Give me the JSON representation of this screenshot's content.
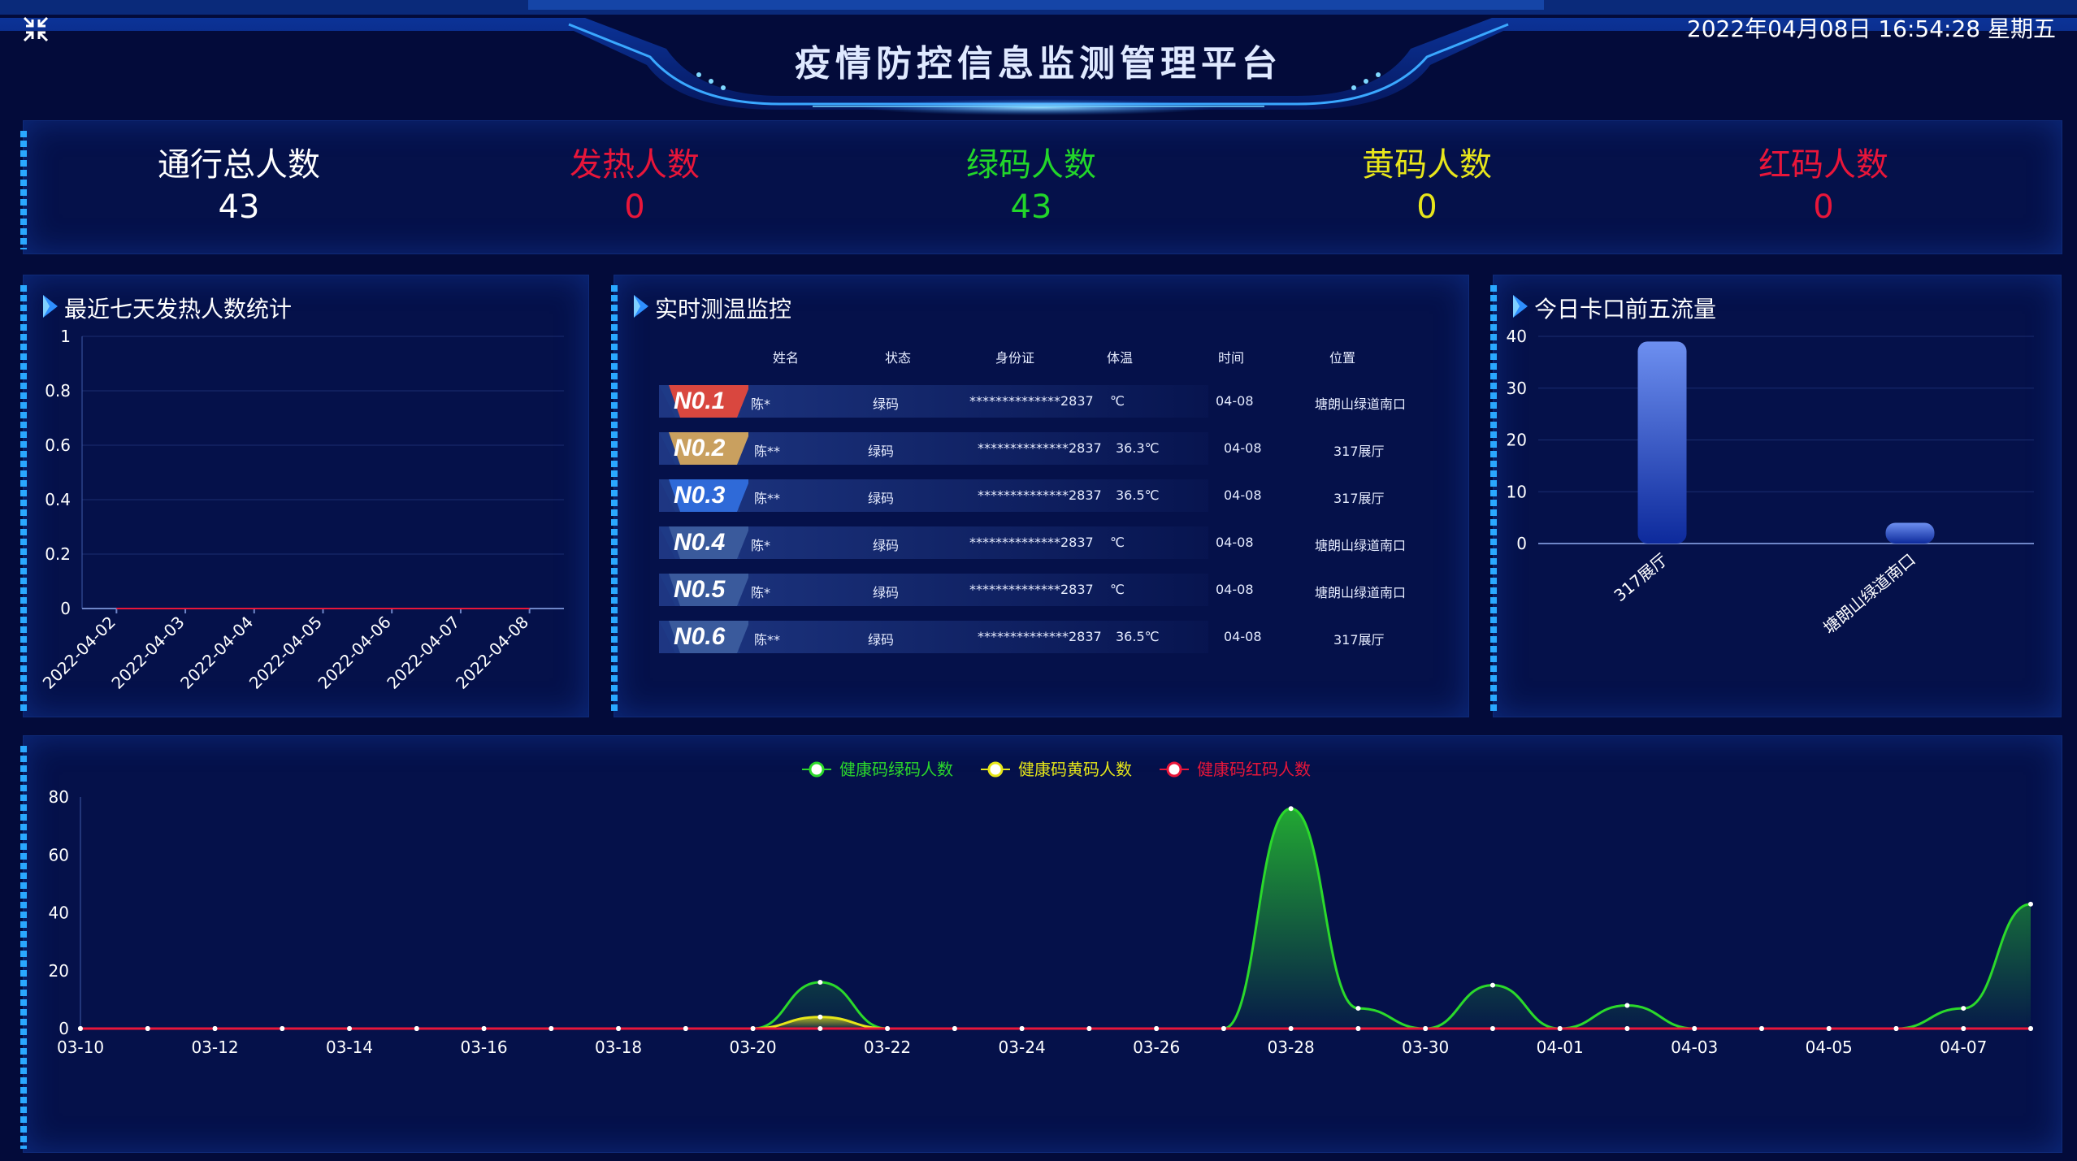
{
  "header": {
    "title": "疫情防控信息监测管理平台",
    "datetime": "2022年04月08日 16:54:28 星期五"
  },
  "stats": [
    {
      "label": "通行总人数",
      "value": "43",
      "color": "#ffffff"
    },
    {
      "label": "发热人数",
      "value": "0",
      "color": "#e8163a"
    },
    {
      "label": "绿码人数",
      "value": "43",
      "color": "#22d62a"
    },
    {
      "label": "黄码人数",
      "value": "0",
      "color": "#e7e51b"
    },
    {
      "label": "红码人数",
      "value": "0",
      "color": "#e8163a"
    }
  ],
  "fever_panel": {
    "title": "最近七天发热人数统计",
    "chart_data": {
      "type": "line",
      "categories": [
        "2022-04-02",
        "2022-04-03",
        "2022-04-04",
        "2022-04-05",
        "2022-04-06",
        "2022-04-07",
        "2022-04-08"
      ],
      "values": [
        0,
        0,
        0,
        0,
        0,
        0,
        0
      ],
      "yticks": [
        "1",
        "0.8",
        "0.6",
        "0.4",
        "0.2",
        "0"
      ],
      "ylim": [
        0,
        1
      ]
    }
  },
  "temp_panel": {
    "title": "实时测温监控",
    "headers": [
      "姓名",
      "状态",
      "身份证",
      "体温",
      "时间",
      "位置"
    ],
    "rows": [
      {
        "rank": "N0.1",
        "name": "陈*",
        "status": "绿码",
        "id": "**************2837",
        "temp": "℃",
        "time": "04-08",
        "location": "塘朗山绿道南口"
      },
      {
        "rank": "N0.2",
        "name": "陈**",
        "status": "绿码",
        "id": "**************2837",
        "temp": "36.3℃",
        "time": "04-08",
        "location": "317展厅"
      },
      {
        "rank": "N0.3",
        "name": "陈**",
        "status": "绿码",
        "id": "**************2837",
        "temp": "36.5℃",
        "time": "04-08",
        "location": "317展厅"
      },
      {
        "rank": "N0.4",
        "name": "陈*",
        "status": "绿码",
        "id": "**************2837",
        "temp": "℃",
        "time": "04-08",
        "location": "塘朗山绿道南口"
      },
      {
        "rank": "N0.5",
        "name": "陈*",
        "status": "绿码",
        "id": "**************2837",
        "temp": "℃",
        "time": "04-08",
        "location": "塘朗山绿道南口"
      },
      {
        "rank": "N0.6",
        "name": "陈**",
        "status": "绿码",
        "id": "**************2837",
        "temp": "36.5℃",
        "time": "04-08",
        "location": "317展厅"
      }
    ],
    "rank_colors": [
      "#d9473f",
      "#c9a05f",
      "#2f6ad8",
      "#3a5a9c",
      "#3a5a9c",
      "#3a5a9c"
    ]
  },
  "gate_panel": {
    "title": "今日卡口前五流量",
    "chart_data": {
      "type": "bar",
      "categories": [
        "317展厅",
        "塘朗山绿道南口"
      ],
      "values": [
        39,
        4
      ],
      "yticks": [
        "40",
        "30",
        "20",
        "10",
        "0"
      ],
      "ylim": [
        0,
        40
      ]
    }
  },
  "trend_panel": {
    "chart_data": {
      "type": "area",
      "x": [
        "03-10",
        "03-11",
        "03-12",
        "03-13",
        "03-14",
        "03-15",
        "03-16",
        "03-17",
        "03-18",
        "03-19",
        "03-20",
        "03-21",
        "03-22",
        "03-23",
        "03-24",
        "03-25",
        "03-26",
        "03-27",
        "03-28",
        "03-29",
        "03-30",
        "03-31",
        "04-01",
        "04-02",
        "04-03",
        "04-04",
        "04-05",
        "04-06",
        "04-07",
        "04-08"
      ],
      "xticks": [
        "03-10",
        "03-12",
        "03-14",
        "03-16",
        "03-18",
        "03-20",
        "03-22",
        "03-24",
        "03-26",
        "03-28",
        "03-30",
        "04-01",
        "04-03",
        "04-05",
        "04-07"
      ],
      "yticks": [
        "80",
        "60",
        "40",
        "20",
        "0"
      ],
      "ylim": [
        0,
        80
      ],
      "series": [
        {
          "name": "健康码绿码人数",
          "color": "#2bd92b",
          "values": [
            0,
            0,
            0,
            0,
            0,
            0,
            0,
            0,
            0,
            0,
            0,
            16,
            0,
            0,
            0,
            0,
            0,
            0,
            76,
            7,
            0,
            15,
            0,
            8,
            0,
            0,
            0,
            0,
            7,
            43
          ]
        },
        {
          "name": "健康码黄码人数",
          "color": "#e6e619",
          "values": [
            0,
            0,
            0,
            0,
            0,
            0,
            0,
            0,
            0,
            0,
            0,
            4,
            0,
            0,
            0,
            0,
            0,
            0,
            0,
            0,
            0,
            0,
            0,
            0,
            0,
            0,
            0,
            0,
            0,
            0
          ]
        },
        {
          "name": "健康码红码人数",
          "color": "#e8163a",
          "values": [
            0,
            0,
            0,
            0,
            0,
            0,
            0,
            0,
            0,
            0,
            0,
            0,
            0,
            0,
            0,
            0,
            0,
            0,
            0,
            0,
            0,
            0,
            0,
            0,
            0,
            0,
            0,
            0,
            0,
            0
          ]
        }
      ]
    }
  }
}
